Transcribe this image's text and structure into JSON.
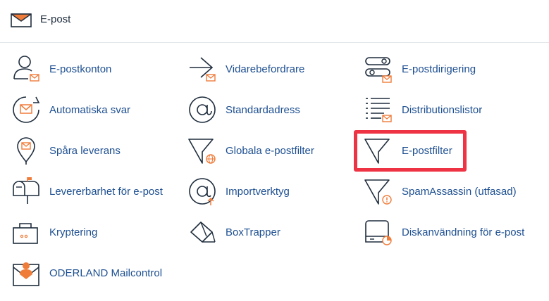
{
  "header": {
    "title": "E-post",
    "icon": "envelope-icon"
  },
  "items": [
    {
      "label": "E-postkonton",
      "icon": "user-mail-icon"
    },
    {
      "label": "Vidarebefordrare",
      "icon": "forward-arrow-icon"
    },
    {
      "label": "E-postdirigering",
      "icon": "routing-icon"
    },
    {
      "label": "Automatiska svar",
      "icon": "autoresponder-icon"
    },
    {
      "label": "Standardadress",
      "icon": "at-sign-icon"
    },
    {
      "label": "Distributionslistor",
      "icon": "list-icon"
    },
    {
      "label": "Spåra leverans",
      "icon": "map-pin-mail-icon"
    },
    {
      "label": "Globala e-postfilter",
      "icon": "globe-filter-icon"
    },
    {
      "label": "E-postfilter",
      "icon": "filter-icon"
    },
    {
      "label": "Levererbarhet för e-post",
      "icon": "mailbox-icon"
    },
    {
      "label": "Importverktyg",
      "icon": "import-at-icon"
    },
    {
      "label": "SpamAssassin (utfasad)",
      "icon": "spam-filter-icon"
    },
    {
      "label": "Kryptering",
      "icon": "lock-briefcase-icon"
    },
    {
      "label": "BoxTrapper",
      "icon": "boxtrapper-icon"
    },
    {
      "label": "Diskanvändning för e-post",
      "icon": "disk-usage-icon"
    },
    {
      "label": "ODERLAND Mailcontrol",
      "icon": "mailcontrol-icon"
    }
  ],
  "highlighted_item": "E-postfilter",
  "colors": {
    "accent": "#f07c3a",
    "link": "#1d4f91",
    "highlight": "#ee3344"
  }
}
